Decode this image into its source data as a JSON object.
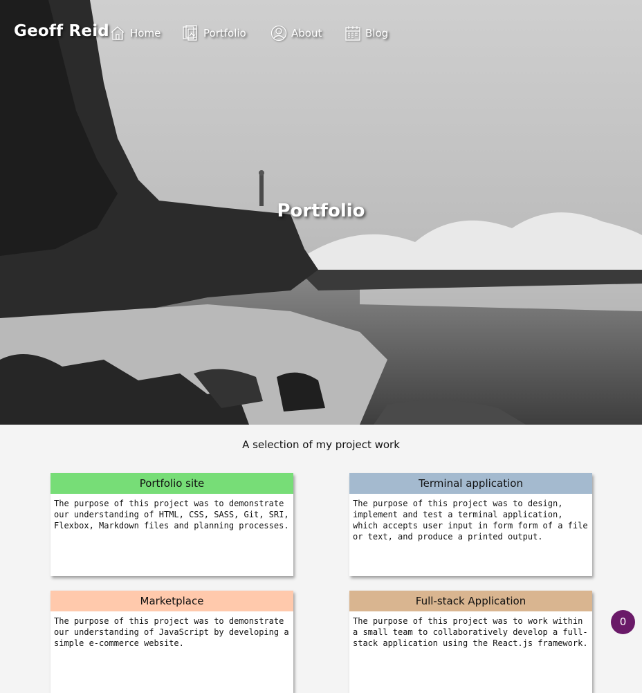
{
  "header": {
    "brand": "Geoff Reid",
    "nav": [
      {
        "label": "Home",
        "icon": "home-icon"
      },
      {
        "label": "Portfolio",
        "icon": "portfolio-icon"
      },
      {
        "label": "About",
        "icon": "user-icon"
      },
      {
        "label": "Blog",
        "icon": "calendar-icon"
      }
    ]
  },
  "hero": {
    "title": "Portfolio",
    "image": "black-and-white-coastal-cliff-photo"
  },
  "main": {
    "subtitle": "A selection of my project work",
    "cards": [
      {
        "title": "Portfolio site",
        "header_color": "#77dd77",
        "description": "The purpose of this project was to demonstrate our understanding of HTML, CSS, SASS, Git, SRI, Flexbox, Markdown files and planning processes."
      },
      {
        "title": "Terminal application",
        "header_color": "#a4bacf",
        "description": "The purpose of this project was to design, implement and test a terminal application, which accepts user input in form form of a file or text, and produce a printed output."
      },
      {
        "title": "Marketplace",
        "header_color": "#ffc9ac",
        "description": "The purpose of this project was to demonstrate our understanding of JavaScript by developing a simple e-commerce website."
      },
      {
        "title": "Full-stack Application",
        "header_color": "#d9b590",
        "description": "The purpose of this project was to work within a small team to collaboratively develop a full-stack application using the React.js framework."
      }
    ]
  },
  "counter_badge": {
    "value": "0",
    "color": "#6a1a68"
  }
}
